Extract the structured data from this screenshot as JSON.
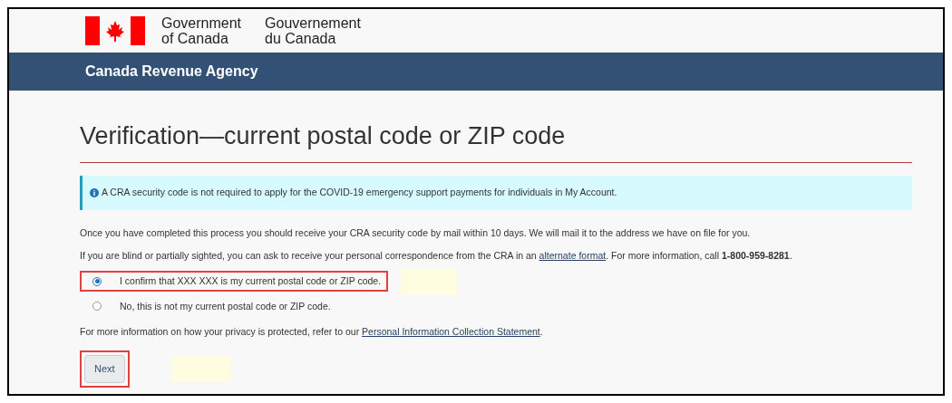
{
  "header": {
    "gov_en": [
      "Government",
      "of Canada"
    ],
    "gov_fr": [
      "Gouvernement",
      "du Canada"
    ],
    "agency": "Canada Revenue Agency"
  },
  "title": "Verification—current postal code or ZIP code",
  "alert": {
    "text": "A CRA security code is not required to apply for the COVID-19 emergency support payments for individuals in My Account."
  },
  "paragraphs": [
    {
      "parts": [
        {
          "text": "Once you have completed this process you should receive your CRA security code by mail within 10 days. We will mail it to the address we have on file for you."
        }
      ]
    },
    {
      "parts": [
        {
          "text": "If you are blind or partially sighted, you can ask to receive your personal correspondence from the CRA in an "
        },
        {
          "text": "alternate format",
          "kind": "link"
        },
        {
          "text": ". For more information, call **1-800-959-8281**."
        }
      ]
    }
  ],
  "options": [
    {
      "label": "I confirm that XXX XXX is my current postal code or ZIP code.",
      "selected": true,
      "highlighted": true
    },
    {
      "label": "No, this is not my current postal code or ZIP code.",
      "selected": false
    }
  ],
  "privacy": {
    "parts": [
      {
        "text": "For more information on how your privacy is protected, refer to our "
      },
      {
        "text": "Personal Information Collection Statement",
        "kind": "link"
      },
      {
        "text": "."
      }
    ]
  },
  "next_button": {
    "label": "Next",
    "highlighted": true
  }
}
